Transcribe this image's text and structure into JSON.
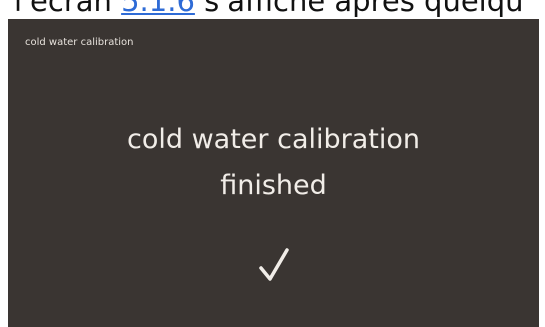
{
  "document": {
    "text_before": "l'écran ",
    "link_text": "5.1.6",
    "text_after": " s'affiche après quelqu"
  },
  "screen": {
    "header": "cold water calibration",
    "message_line1": "cold water calibration",
    "message_line2": "finished",
    "status_icon": "checkmark-icon",
    "colors": {
      "background": "#3a3532",
      "text": "#f1ede8",
      "link": "#2e6bd6"
    }
  }
}
